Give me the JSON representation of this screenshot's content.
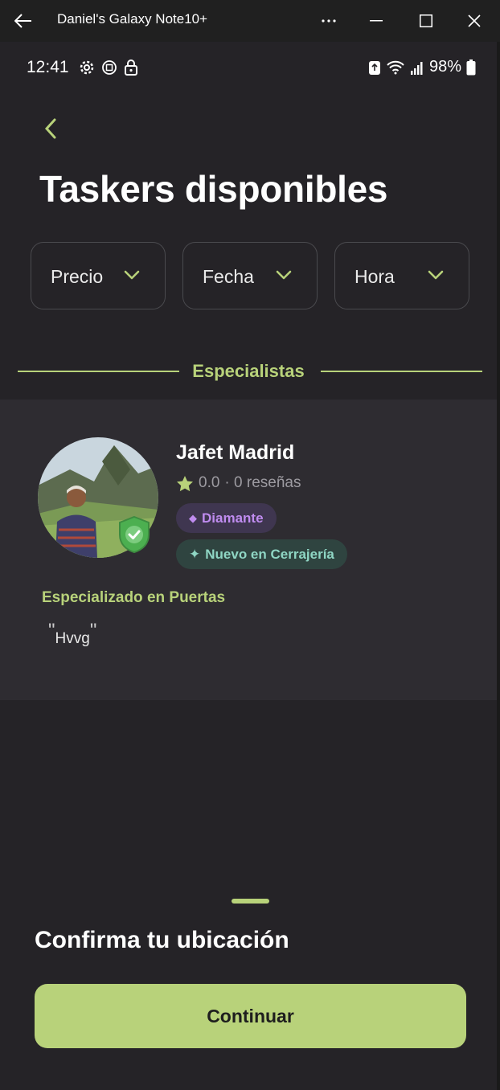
{
  "window": {
    "title": "Daniel's Galaxy Note10+"
  },
  "status_bar": {
    "time": "12:41",
    "battery": "98%",
    "left_icons": [
      "gear-icon",
      "scan-icon",
      "lock-icon"
    ],
    "right_icons": [
      "recycle-icon",
      "wifi-icon",
      "signal-icon",
      "battery-icon"
    ]
  },
  "page": {
    "title": "Taskers disponibles"
  },
  "filters": [
    {
      "label": "Precio"
    },
    {
      "label": "Fecha"
    },
    {
      "label": "Hora"
    }
  ],
  "section": {
    "label": "Especialistas"
  },
  "tasker": {
    "name": "Jafet Madrid",
    "rating": "0.0",
    "reviews": "· 0 reseñas",
    "badges": [
      {
        "icon": "◆",
        "label": "Diamante"
      },
      {
        "icon": "✦",
        "label": "Nuevo en Cerrajería"
      }
    ],
    "specialization": "Especializado en Puertas",
    "quote": "Hvvg"
  },
  "bottom_sheet": {
    "title": "Confirma tu ubicación",
    "button_label": "Continuar"
  },
  "colors": {
    "accent": "#b8d27a",
    "background": "#252327",
    "card": "#2e2c31",
    "diamond": "#c08cf0",
    "new": "#8fd6c4"
  }
}
